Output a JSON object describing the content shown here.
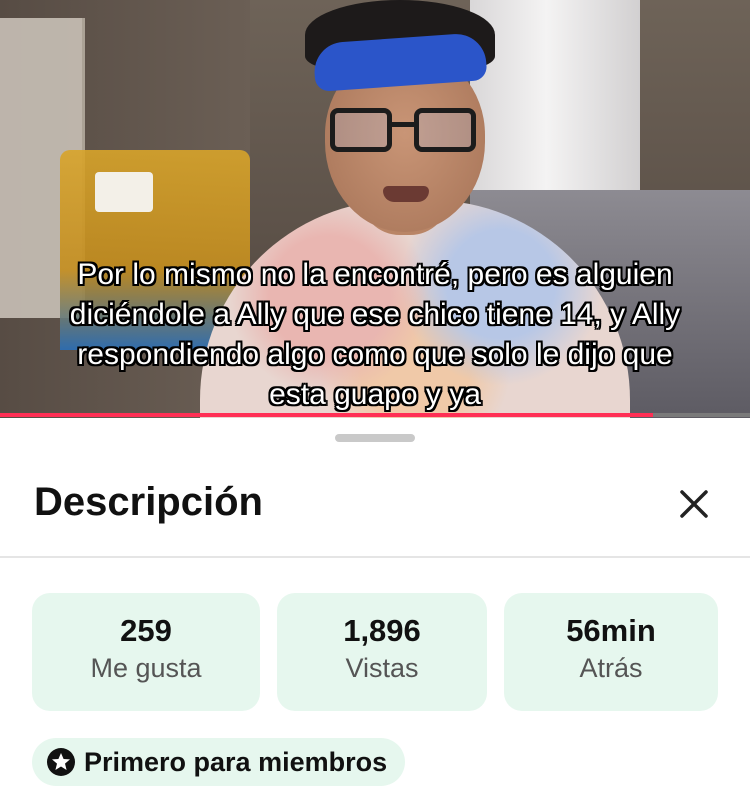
{
  "video": {
    "subtitle": "Por lo mismo no la encontré, pero es alguien\ndiciéndole a Ally que ese chico tiene 14, y Ally\nrespondiendo algo como que solo le dijo que\nesta guapo y ya",
    "progress_fraction": 0.87,
    "progress_color": "#ff2f55"
  },
  "sheet": {
    "title": "Descripción",
    "close_icon": "close-icon",
    "stats": [
      {
        "value": "259",
        "label": "Me gusta"
      },
      {
        "value": "1,896",
        "label": "Vistas"
      },
      {
        "value": "56min",
        "label": "Atrás"
      }
    ],
    "chip": {
      "icon": "star-badge-icon",
      "label": "Primero para miembros"
    },
    "accent_bg": "#e6f7ee"
  }
}
